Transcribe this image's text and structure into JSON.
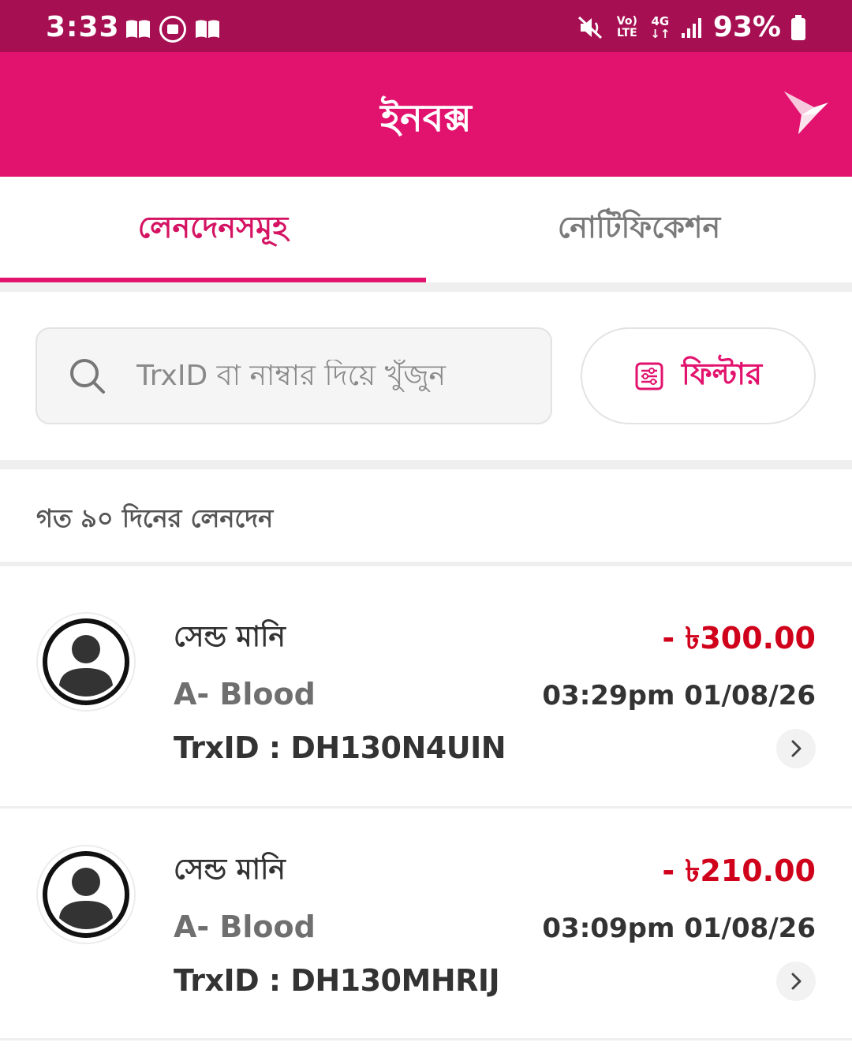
{
  "status_bar": {
    "time": "3:33",
    "volte_line1": "Vo)",
    "volte_line2": "LTE",
    "network_line1": "4G",
    "network_line2": "↓↑",
    "battery": "93%"
  },
  "app_bar": {
    "title": "ইনবক্স"
  },
  "tabs": [
    {
      "label": "লেনদেনসমূহ",
      "active": true
    },
    {
      "label": "নোটিফিকেশন",
      "active": false
    }
  ],
  "search": {
    "placeholder": "TrxID বা নাম্বার দিয়ে খুঁজুন"
  },
  "filter": {
    "label": "ফিল্টার"
  },
  "section": {
    "label": "গত ৯০ দিনের লেনদেন"
  },
  "transactions": [
    {
      "type": "সেন্ড মানি",
      "name": "A- Blood",
      "trx_id": "TrxID : DH130N4UIN",
      "amount": "- ৳300.00",
      "datetime": "03:29pm 01/08/26"
    },
    {
      "type": "সেন্ড মানি",
      "name": "A- Blood",
      "trx_id": "TrxID : DH130MHRIJ",
      "amount": "- ৳210.00",
      "datetime": "03:09pm 01/08/26"
    }
  ],
  "colors": {
    "status_bar": "#a60f52",
    "brand": "#e2136e",
    "amount_negative": "#d0021b"
  }
}
